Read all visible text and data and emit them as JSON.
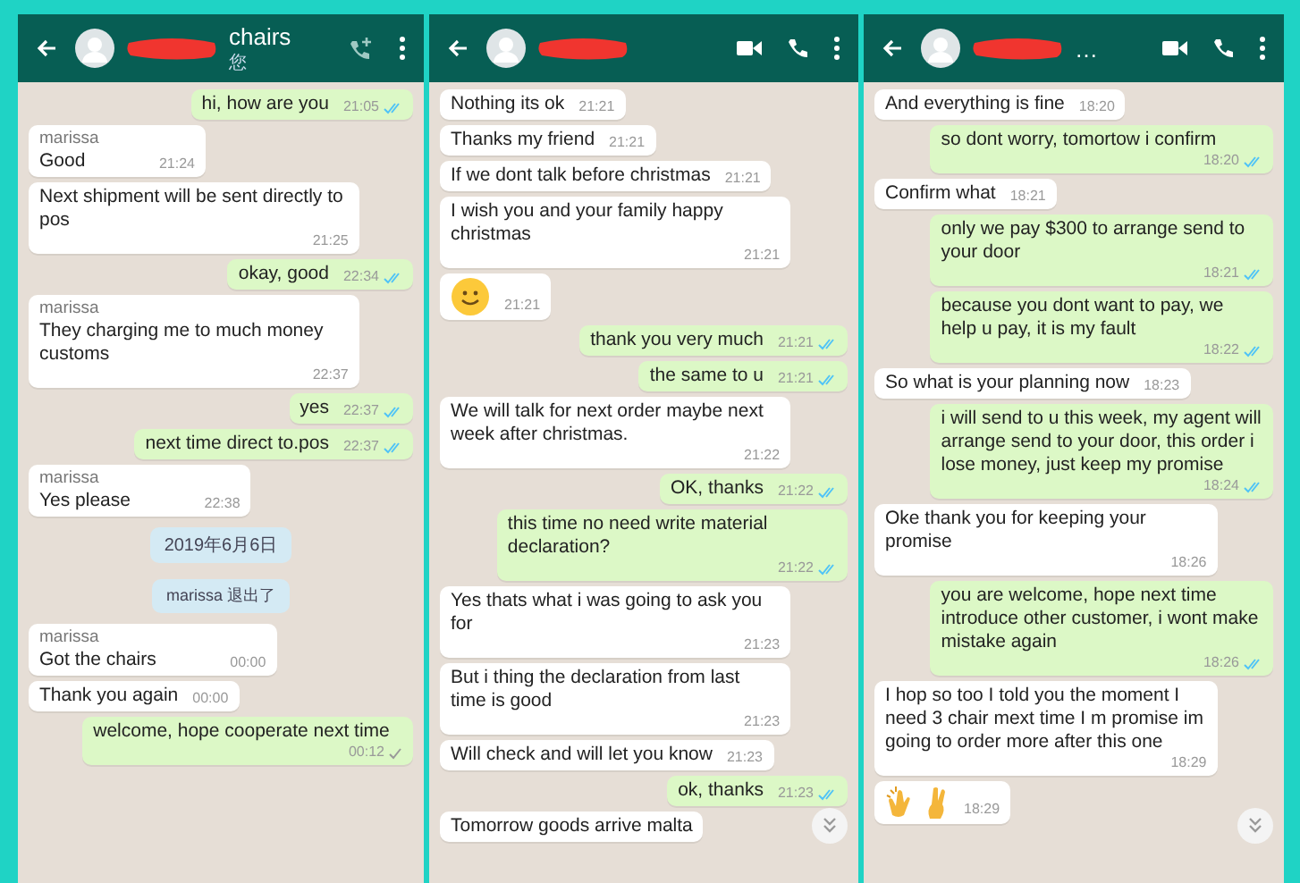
{
  "panels": [
    {
      "header": {
        "title": "chairs",
        "subtitle": "您",
        "kind": "group"
      },
      "scroll_button": false,
      "messages": [
        {
          "kind": "out",
          "text": "hi, how are you",
          "time": "21:05",
          "read": true
        },
        {
          "kind": "in",
          "sender": "marissa",
          "text": "Good",
          "time": "21:24"
        },
        {
          "kind": "in",
          "text": "Next shipment will be sent directly to pos",
          "time": "21:25"
        },
        {
          "kind": "out",
          "text": "okay, good",
          "time": "22:34",
          "read": true
        },
        {
          "kind": "in",
          "sender": "marissa",
          "text": "They charging me to much money customs",
          "time": "22:37"
        },
        {
          "kind": "out",
          "text": "yes",
          "time": "22:37",
          "read": true
        },
        {
          "kind": "out",
          "text": "next time direct to.pos",
          "time": "22:37",
          "read": true
        },
        {
          "kind": "in",
          "sender": "marissa",
          "text": "Yes please",
          "time": "22:38"
        },
        {
          "kind": "date",
          "text": "2019年6月6日"
        },
        {
          "kind": "system",
          "text": "marissa 退出了"
        },
        {
          "kind": "in",
          "sender": "marissa",
          "text": "Got the chairs",
          "time": "00:00"
        },
        {
          "kind": "in",
          "text": "Thank you again",
          "time": "00:00"
        },
        {
          "kind": "out",
          "text": "welcome, hope cooperate next time",
          "time": "00:12",
          "read": false
        }
      ]
    },
    {
      "header": {
        "kind": "contact"
      },
      "scroll_button": true,
      "messages": [
        {
          "kind": "in",
          "text": "Nothing its ok",
          "time": "21:21"
        },
        {
          "kind": "in",
          "text": "Thanks my friend",
          "time": "21:21"
        },
        {
          "kind": "in",
          "text": "If we dont talk before christmas",
          "time": "21:21"
        },
        {
          "kind": "in",
          "text": "I wish you and your family happy christmas",
          "time": "21:21"
        },
        {
          "kind": "smiley",
          "time": "21:21"
        },
        {
          "kind": "out",
          "text": "thank you very much",
          "time": "21:21",
          "read": true
        },
        {
          "kind": "out",
          "text": "the same to u",
          "time": "21:21",
          "read": true
        },
        {
          "kind": "in",
          "text": "We will talk for next order maybe next week after christmas.",
          "time": "21:22"
        },
        {
          "kind": "out",
          "text": "OK,  thanks",
          "time": "21:22",
          "read": true
        },
        {
          "kind": "out",
          "text": "this time no need write  material declaration?",
          "time": "21:22",
          "read": true
        },
        {
          "kind": "in",
          "text": "Yes thats what i was going to ask you for",
          "time": "21:23"
        },
        {
          "kind": "in",
          "text": "But i thing the declaration from last time is good",
          "time": "21:23"
        },
        {
          "kind": "in",
          "text": "Will check and will let you know",
          "time": "21:23"
        },
        {
          "kind": "out",
          "text": "ok, thanks",
          "time": "21:23",
          "read": true
        },
        {
          "kind": "in",
          "text": "Tomorrow goods arrive malta"
        }
      ]
    },
    {
      "header": {
        "title": "…",
        "kind": "contact"
      },
      "scroll_button": true,
      "messages": [
        {
          "kind": "in",
          "text": "And everything is fine",
          "time": "18:20"
        },
        {
          "kind": "out",
          "text": "so dont worry, tomortow i confirm",
          "time": "18:20",
          "read": true
        },
        {
          "kind": "in",
          "text": "Confirm what",
          "time": "18:21"
        },
        {
          "kind": "out",
          "text": "only we pay $300 to arrange send to your door",
          "time": "18:21",
          "read": true
        },
        {
          "kind": "out",
          "text": "because you dont want to pay, we help u pay, it is my fault",
          "time": "18:22",
          "read": true
        },
        {
          "kind": "in",
          "text": "So what is your planning now",
          "time": "18:23"
        },
        {
          "kind": "out",
          "text": "i will send to u this week, my agent will arrange send to your door,  this order i lose money, just keep my promise",
          "time": "18:24",
          "read": true
        },
        {
          "kind": "in",
          "text": "Oke thank you for keeping your promise",
          "time": "18:26"
        },
        {
          "kind": "out",
          "text": "you are welcome, hope next time introduce other customer, i wont make mistake again",
          "time": "18:26",
          "read": true
        },
        {
          "kind": "in",
          "text": "I hop so too I told you the moment  I need 3 chair mext time I m promise im going to order  more  after this one",
          "time": "18:29"
        },
        {
          "kind": "gesture",
          "time": "18:29"
        }
      ]
    }
  ]
}
